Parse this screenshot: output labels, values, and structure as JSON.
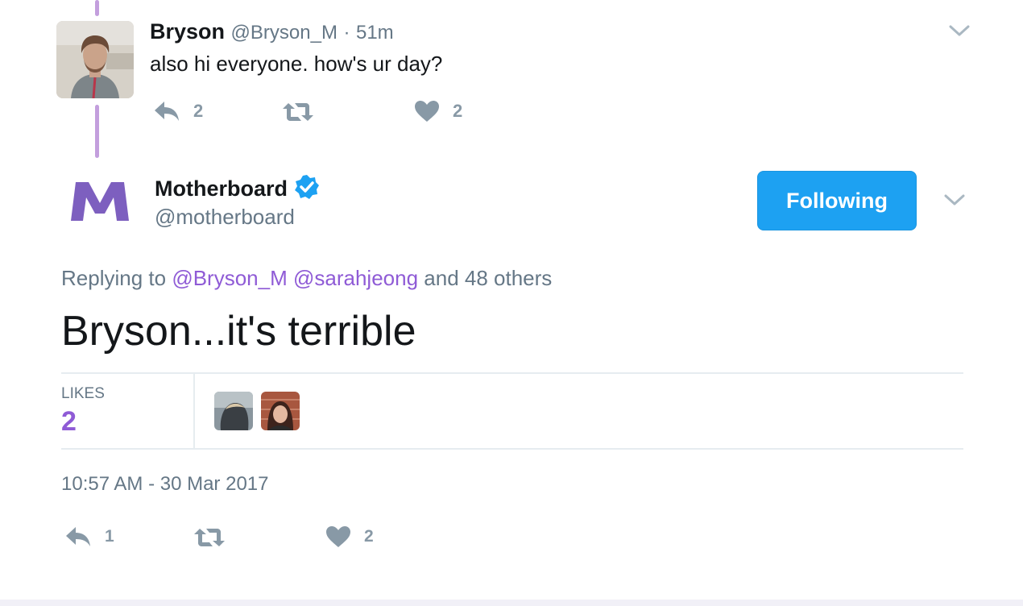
{
  "parent_tweet": {
    "display_name": "Bryson",
    "handle": "@Bryson_M",
    "separator": "·",
    "time_ago": "51m",
    "text": "also hi everyone. how's ur day?",
    "reply_count": "2",
    "like_count": "2",
    "icons": {
      "reply": "reply-icon",
      "retweet": "retweet-icon",
      "like": "heart-icon",
      "menu": "chevron-down-icon"
    }
  },
  "main_tweet": {
    "display_name": "Motherboard",
    "handle": "@motherboard",
    "verified": true,
    "logo_letter": "M",
    "follow_button_label": "Following",
    "replying_prefix": "Replying to",
    "replying_users": [
      "@Bryson_M",
      "@sarahjeong"
    ],
    "replying_suffix": "and 48 others",
    "text": "Bryson...it's terrible",
    "likes_label": "LIKES",
    "likes_count": "2",
    "timestamp": "10:57 AM - 30 Mar 2017",
    "reply_count": "1",
    "like_count": "2"
  },
  "colors": {
    "accent_blue": "#1da1f2",
    "link_purple": "#8f5bd6",
    "logo_purple": "#7d5fbf",
    "thread_line": "#c39fdd",
    "icon_gray": "#8899a6",
    "muted_text": "#657786"
  }
}
